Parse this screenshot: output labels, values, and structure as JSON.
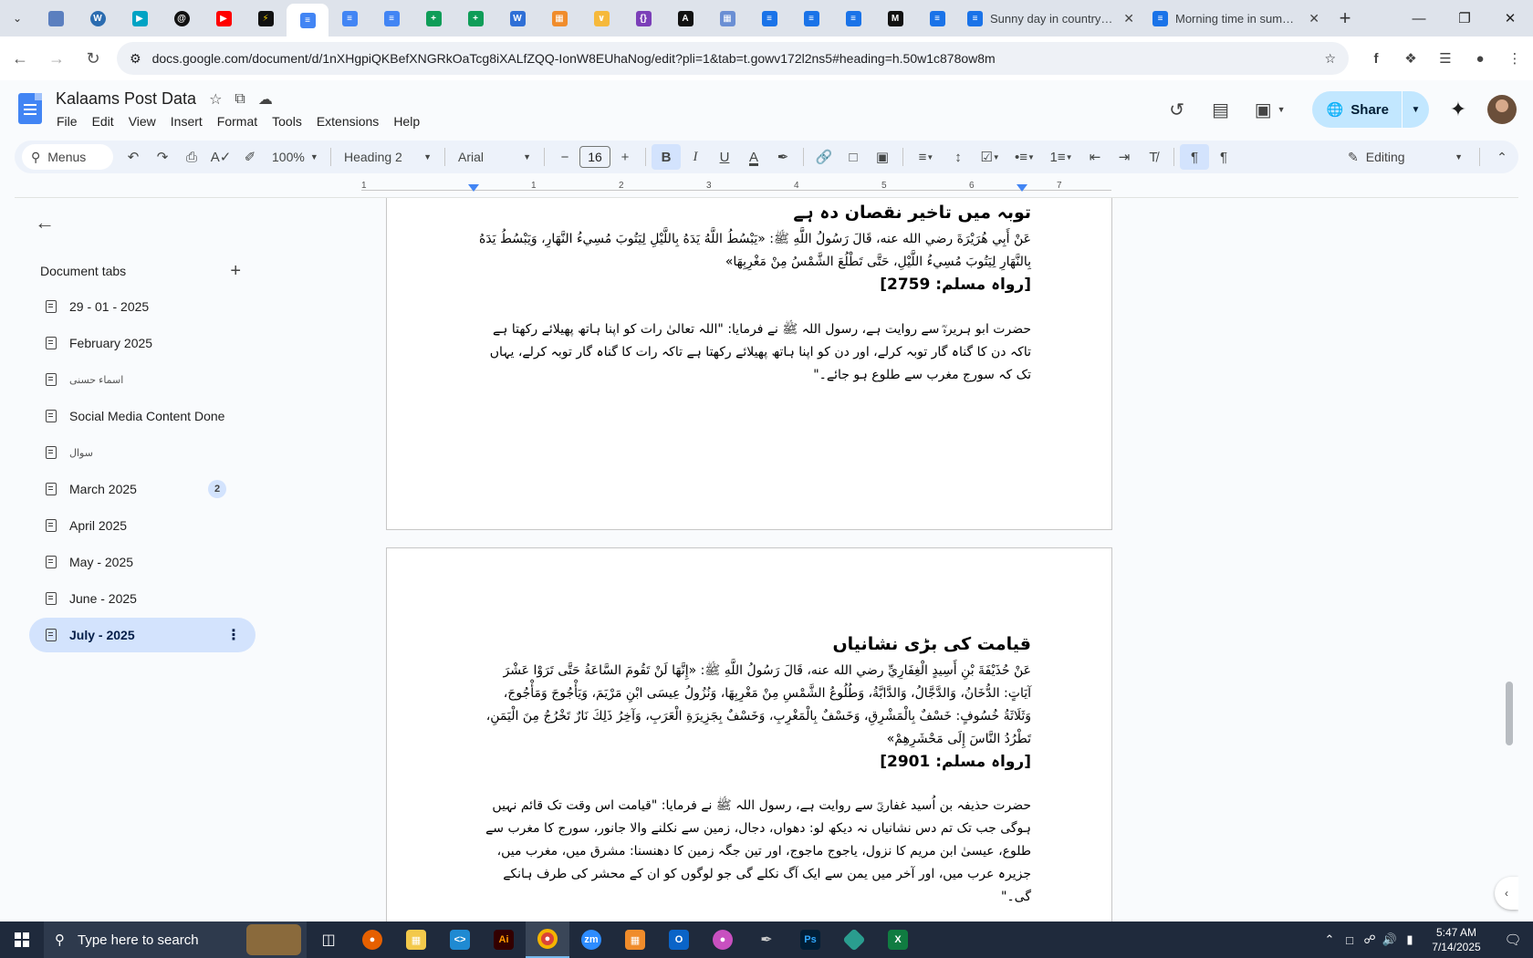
{
  "browser": {
    "tabs": [
      {
        "title": "Sunny day in countryside"
      },
      {
        "title": "Morning time in summer"
      }
    ],
    "url": "docs.google.com/document/d/1nXHgpiQKBefXNGRkOaTcg8iXALfZQQ-IonW8EUhaNog/edit?pli=1&tab=t.gowv172l2ns5#heading=h.50w1c878ow8m",
    "colors": {
      "tabstrip": "#dee3eb",
      "accent": "#1a73e8"
    }
  },
  "docs": {
    "title": "Kalaams Post Data",
    "menu": [
      "File",
      "Edit",
      "View",
      "Insert",
      "Format",
      "Tools",
      "Extensions",
      "Help"
    ],
    "share_label": "Share"
  },
  "toolbar": {
    "menus_label": "Menus",
    "zoom": "100%",
    "style": "Heading 2",
    "font": "Arial",
    "font_size": "16",
    "mode": "Editing"
  },
  "ruler": {
    "numbers": [
      "1",
      "1",
      "2",
      "3",
      "4",
      "5",
      "6",
      "7"
    ]
  },
  "sidebar": {
    "header": "Document tabs",
    "tabs": [
      {
        "label": "29 - 01 - 2025"
      },
      {
        "label": "February 2025"
      },
      {
        "label": "اسماء حسنی"
      },
      {
        "label": "Social Media Content Done"
      },
      {
        "label": "سوال"
      },
      {
        "label": "March 2025",
        "badge": "2"
      },
      {
        "label": "April 2025"
      },
      {
        "label": "May - 2025"
      },
      {
        "label": "June - 2025"
      },
      {
        "label": "July - 2025"
      }
    ]
  },
  "content": {
    "page1": {
      "heading": "توبہ میں تاخیر نقصان دہ ہے",
      "arabic": "عَنْ أَبِي هُرَيْرَةَ رضي الله عنه، قَالَ رَسُولُ اللَّهِ ﷺ: «يَبْسُطُ اللَّهُ يَدَهُ بِاللَّيْلِ لِيَتُوبَ مُسِيءُ النَّهَارِ، وَيَبْسُطُ يَدَهُ بِالنَّهَارِ لِيَتُوبَ مُسِيءُ اللَّيْلِ، حَتَّى تَطْلُعَ الشَّمْسُ مِنْ مَغْرِبِهَا»",
      "reference": "[رواہ مسلم: 2759]",
      "urdu": "حضرت ابو ہریرہؓ سے روایت ہے، رسول اللہ ﷺ نے فرمایا: \"اللہ تعالیٰ رات کو اپنا ہاتھ پھیلائے رکھتا ہے تاکہ دن کا گناہ گار توبہ کرلے، اور دن کو اپنا ہاتھ پھیلائے رکھتا ہے تاکہ رات کا گناہ گار توبہ کرلے، یہاں تک کہ سورج مغرب سے طلوع ہو جائے۔\""
    },
    "page2": {
      "heading": "قیامت کی بڑی نشانیاں",
      "arabic": "عَنْ حُذَيْفَةَ بْنِ أَسِيدٍ الْغِفَارِيِّ رضي الله عنه، قَالَ رَسُولُ اللَّهِ ﷺ: «إِنَّهَا لَنْ تَقُومَ السَّاعَةُ حَتَّى تَرَوْا عَشْرَ آيَاتٍ: الدُّخَانُ، وَالدَّجَّالُ، وَالدَّابَّةُ، وَطُلُوعُ الشَّمْسِ مِنْ مَغْرِبِهَا، وَنُزُولُ عِيسَى ابْنِ مَرْيَمَ، وَيَأْجُوجَ وَمَأْجُوجَ، وَثَلَاثَةُ خُسُوفٍ: خَسْفٌ بِالْمَشْرِقِ، وَخَسْفٌ بِالْمَغْرِبِ، وَخَسْفٌ بِجَزِيرَةِ الْعَرَبِ، وَآخِرُ ذَلِكَ نَارٌ تَخْرُجُ مِنَ الْيَمَنِ، تَطْرُدُ النَّاسَ إِلَى مَحْشَرِهِمْ»",
      "reference": "[رواہ مسلم: 2901]",
      "urdu": "حضرت حذیفہ بن اُسید غفاریؓ سے روایت ہے، رسول اللہ ﷺ نے فرمایا: \"قیامت اس وقت تک قائم نہیں ہوگی جب تک تم دس نشانیاں نہ دیکھ لو: دھواں، دجال، زمین سے نکلنے والا جانور، سورج کا مغرب سے طلوع، عیسیٰ ابن مریم کا نزول، یاجوج ماجوج، اور تین جگہ زمین کا دھنسنا: مشرق میں، مغرب میں، جزیرہ عرب میں، اور آخر میں یمن سے ایک آگ نکلے گی جو لوگوں کو ان کے محشر کی طرف ہانکے گی۔\""
    }
  },
  "taskbar": {
    "search_placeholder": "Type here to search",
    "time": "5:47 AM",
    "date": "7/14/2025"
  }
}
